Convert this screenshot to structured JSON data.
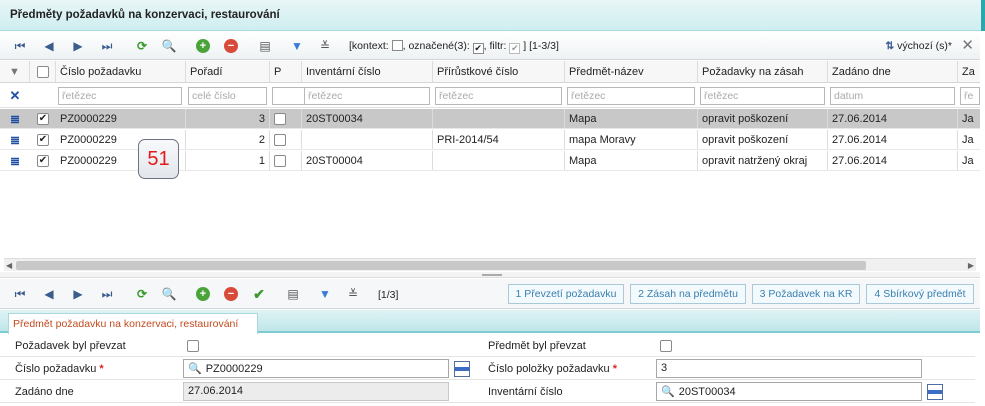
{
  "window": {
    "title": "Předměty požadavků na konzervaci, restaurování"
  },
  "toolbar1": {
    "info_prefix": "[kontext:",
    "info_mid": ", označené(3):",
    "info_filter": ", filtr:",
    "info_suffix": "] [1-3/3]",
    "context_checked": false,
    "marked_checked": true,
    "filter_checked": true,
    "view_label": "výchozí (s)*"
  },
  "grid": {
    "columns": [
      "Číslo požadavku",
      "Pořadí",
      "P",
      "Inventární číslo",
      "Přírůstkové číslo",
      "Předmět-název",
      "Požadavky na zásah",
      "Zadáno dne",
      "Za"
    ],
    "filters": [
      "řetězec",
      "celé číslo",
      "",
      "řetězec",
      "řetězec",
      "řetězec",
      "řetězec",
      "datum",
      "ře"
    ],
    "rows": [
      {
        "checked": true,
        "cislo": "PZ0000229",
        "poradi": "3",
        "p": false,
        "inv": "20ST00034",
        "prir": "",
        "nazev": "Mapa",
        "pozadavky": "opravit poškození",
        "zadano": "27.06.2014",
        "za": "Ja",
        "selected": true
      },
      {
        "checked": true,
        "cislo": "PZ0000229",
        "poradi": "2",
        "p": false,
        "inv": "",
        "prir": "PRI-2014/54",
        "nazev": "mapa Moravy",
        "pozadavky": "opravit poškození",
        "zadano": "27.06.2014",
        "za": "Ja",
        "selected": false
      },
      {
        "checked": true,
        "cislo": "PZ0000229",
        "poradi": "1",
        "p": false,
        "inv": "20ST00004",
        "prir": "",
        "nazev": "Mapa",
        "pozadavky": "opravit natržený okraj",
        "zadano": "27.06.2014",
        "za": "Ja",
        "selected": false
      }
    ]
  },
  "badge": "51",
  "toolbar2": {
    "page_info": "[1/3]",
    "tabs": [
      "1 Převzetí požadavku",
      "2 Zásah na předmětu",
      "3 Požadavek na KR",
      "4 Sbírkový předmět"
    ]
  },
  "form": {
    "tab_label": "Předmět požadavku na konzervaci, restaurování",
    "left": {
      "prevzat_label": "Požadavek byl převzat",
      "cislo_label": "Číslo požadavku",
      "cislo_value": "PZ0000229",
      "zadano_label": "Zadáno dne",
      "zadano_value": "27.06.2014"
    },
    "right": {
      "prevzat_label": "Předmět byl převzat",
      "polozka_label": "Číslo položky požadavku",
      "polozka_value": "3",
      "inv_label": "Inventární číslo",
      "inv_value": "20ST00034"
    }
  },
  "icons": {
    "first": "first-page-icon",
    "prev": "prev-icon",
    "next": "next-icon",
    "last": "last-page-icon",
    "refresh": "refresh-icon",
    "search": "search-icon",
    "add": "add-icon",
    "delete": "delete-icon",
    "save": "save-icon",
    "filter": "filter-icon",
    "clear_filter": "clear-filter-icon",
    "sort": "sort-icon",
    "tools": "tools-icon",
    "confirm": "confirm-icon"
  },
  "colors": {
    "accent": "#2aa7b0",
    "selected_row": "#c8c8c8",
    "tab_text": "#c44a1e",
    "required": "#d22222"
  }
}
